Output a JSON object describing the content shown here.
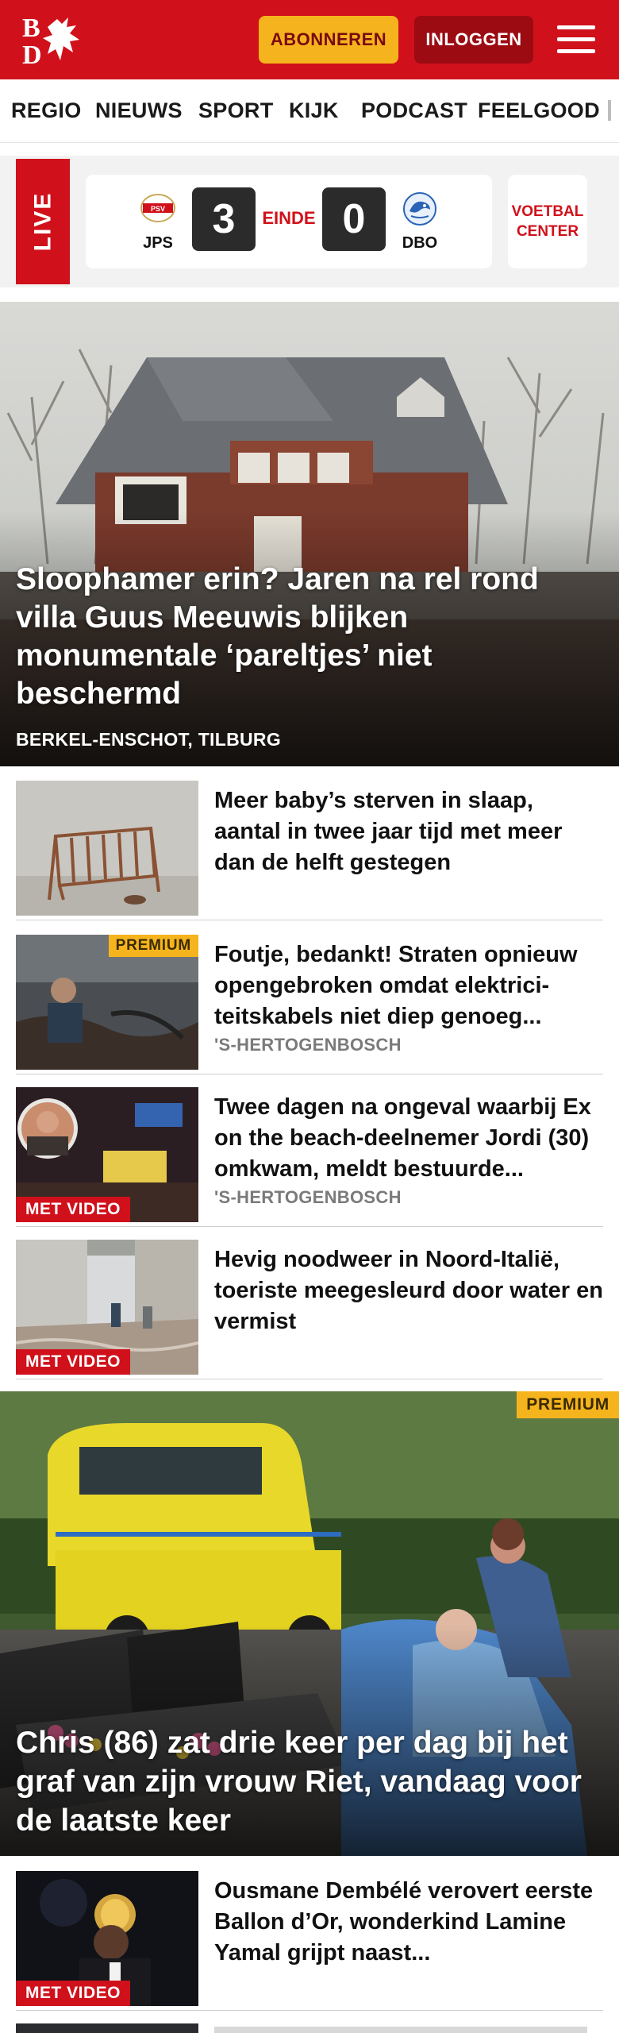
{
  "header": {
    "logo_text": "BD",
    "subscribe_label": "ABONNEREN",
    "login_label": "INLOGGEN",
    "colors": {
      "brand_red": "#d0111b",
      "accent_yellow": "#f5b41d",
      "login_dark_red": "#9c0a12"
    }
  },
  "nav": {
    "items": [
      {
        "label": "REGIO"
      },
      {
        "label": "NIEUWS"
      },
      {
        "label": "SPORT"
      },
      {
        "label": "KIJK"
      },
      {
        "label": "PODCAST"
      },
      {
        "label": "FEELGOOD"
      }
    ]
  },
  "live": {
    "tab_label": "LIVE",
    "home_team": "JPS",
    "home_score": "3",
    "status": "EINDE",
    "away_score": "0",
    "away_team": "DBO",
    "voetbal_center_line1": "VOETBAL",
    "voetbal_center_line2": "CENTER"
  },
  "hero": {
    "title": "Sloophamer erin? Jaren na rel rond villa Guus Meeuwis blijken monumentale ‘pareltjes’ niet beschermd",
    "location": "BERKEL-ENSCHOT, TILBURG"
  },
  "articles": [
    {
      "title": "Meer baby’s sterven in slaap, aantal in twee jaar tijd met meer dan de helft gestegen",
      "location": "",
      "badge": ""
    },
    {
      "title": "Foutje, bedankt! Straten opnieuw opengebroken omdat elektrici­teitskabels niet diep genoeg...",
      "location": "'S-HERTOGENBOSCH",
      "badge": "PREMIUM"
    },
    {
      "title": "Twee dagen na ongeval waarbij Ex on the beach-deelnemer Jordi (30) omkwam, meldt bestuurde...",
      "location": "'S-HERTOGENBOSCH",
      "badge": "MET VIDEO"
    },
    {
      "title": "Hevig noodweer in Noord-Italië, toeriste meegesleurd door water en vermist",
      "location": "",
      "badge": "MET VIDEO"
    }
  ],
  "hero2": {
    "badge": "PREMIUM",
    "title": "Chris (86) zat drie keer per dag bij het graf van zijn vrouw Riet, vandaag voor de laatste keer"
  },
  "articles2": [
    {
      "title": "Ousmane Dembélé verovert eerste Ballon d’Or, wonderkind Lamine Yamal grijpt naast...",
      "badge": "MET VIDEO"
    }
  ]
}
